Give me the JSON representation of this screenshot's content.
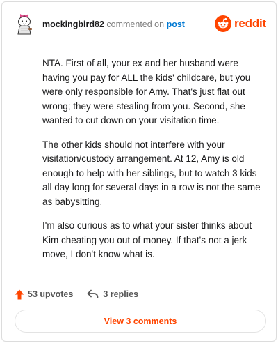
{
  "comment": {
    "username": "mockingbird82",
    "action_text": "commented on",
    "post_link": "post",
    "body": [
      "NTA. First of all, your ex and her husband were having you pay for ALL the kids' childcare, but you were only responsible for Amy. That's just flat out wrong; they were stealing from you. Second, she wanted to cut down on your visitation time.",
      "The other kids should not interfere with your visitation/custody arrangement. At 12, Amy is old enough to help with her siblings, but to watch 3 kids all day long for several days in a row is not the same as babysitting.",
      "I'm also curious as to what your sister thinks about Kim cheating you out of money. If that's not a jerk move, I don't know what is."
    ]
  },
  "brand": {
    "wordmark": "reddit",
    "icon": "reddit-alien-icon",
    "color": "#ff4500"
  },
  "footer": {
    "upvotes": "53 upvotes",
    "upvote_icon": "upvote-arrow-icon",
    "replies": "3 replies",
    "reply_icon": "reply-arrow-icon"
  },
  "view_comments_label": "View 3 comments"
}
